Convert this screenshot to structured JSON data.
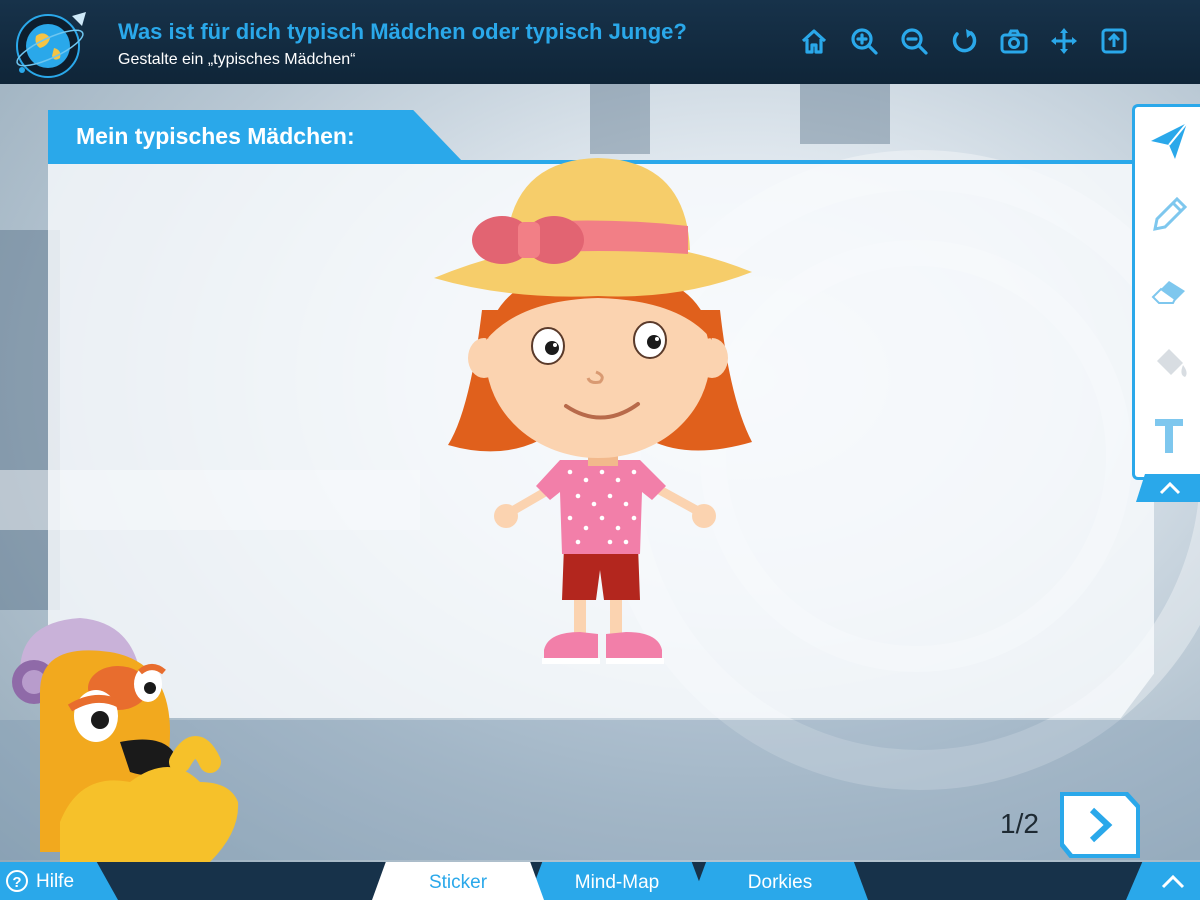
{
  "header": {
    "title": "Was ist für dich typisch Mädchen oder typisch Junge?",
    "subtitle": "Gestalte ein „typisches Mädchen“"
  },
  "toolbar_top": {
    "icons": [
      "home-icon",
      "zoom-in-icon",
      "zoom-out-icon",
      "reset-icon",
      "camera-icon",
      "move-icon",
      "upload-icon"
    ]
  },
  "panel": {
    "heading": "Mein typisches Mädchen:"
  },
  "side_tools": [
    "send-icon",
    "pencil-icon",
    "eraser-icon",
    "fill-bucket-icon",
    "text-icon"
  ],
  "pager": {
    "text": "1/2"
  },
  "bottom": {
    "help_label": "Hilfe",
    "tabs": [
      {
        "label": "Sticker",
        "active": true
      },
      {
        "label": "Mind-Map",
        "active": false
      },
      {
        "label": "Dorkies",
        "active": false
      }
    ]
  },
  "colors": {
    "accent": "#2aa8ea",
    "header_bg": "#17324a",
    "white": "#ffffff"
  }
}
